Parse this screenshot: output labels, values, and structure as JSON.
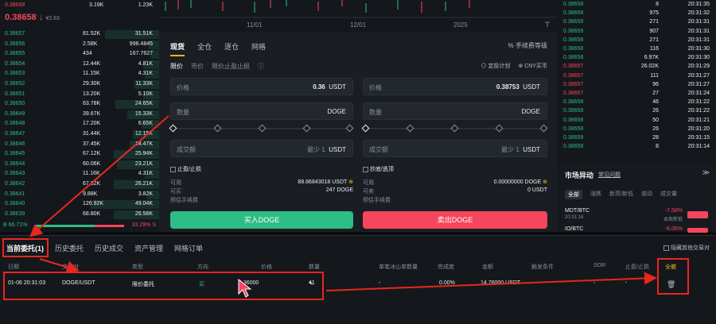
{
  "colors": {
    "buy": "#2ebd85",
    "sell": "#f6465d",
    "accent": "#f0b90b",
    "annotation": "#e8271f"
  },
  "orderbook": {
    "top_row": {
      "price": "0.38658",
      "qty": "3.19K",
      "total": "1.23K"
    },
    "mid_price": "0.38658",
    "mid_arrow": "↓",
    "mid_fiat": "¥2.83",
    "rows": [
      {
        "price": "0.38657",
        "qty": "81.52K",
        "total": "31.51K",
        "bar": 0.62
      },
      {
        "price": "0.38656",
        "qty": "2.58K",
        "total": "998.4845",
        "bar": 0.12
      },
      {
        "price": "0.38655",
        "qty": "434",
        "total": "167.7627",
        "bar": 0.1
      },
      {
        "price": "0.38654",
        "qty": "12.44K",
        "total": "4.81K",
        "bar": 0.18
      },
      {
        "price": "0.38653",
        "qty": "11.15K",
        "total": "4.31K",
        "bar": 0.16
      },
      {
        "price": "0.38652",
        "qty": "29.30K",
        "total": "11.33K",
        "bar": 0.28
      },
      {
        "price": "0.38651",
        "qty": "13.20K",
        "total": "5.10K",
        "bar": 0.18
      },
      {
        "price": "0.38650",
        "qty": "63.78K",
        "total": "24.65K",
        "bar": 0.5
      },
      {
        "price": "0.38649",
        "qty": "39.67K",
        "total": "15.33K",
        "bar": 0.36
      },
      {
        "price": "0.38648",
        "qty": "17.20K",
        "total": "6.65K",
        "bar": 0.2
      },
      {
        "price": "0.38647",
        "qty": "31.44K",
        "total": "12.15K",
        "bar": 0.3
      },
      {
        "price": "0.38646",
        "qty": "37.45K",
        "total": "14.47K",
        "bar": 0.34
      },
      {
        "price": "0.38645",
        "qty": "67.12K",
        "total": "25.94K",
        "bar": 0.52
      },
      {
        "price": "0.38644",
        "qty": "60.06K",
        "total": "23.21K",
        "bar": 0.48
      },
      {
        "price": "0.38643",
        "qty": "11.16K",
        "total": "4.31K",
        "bar": 0.16
      },
      {
        "price": "0.38642",
        "qty": "67.82K",
        "total": "26.21K",
        "bar": 0.52
      },
      {
        "price": "0.38641",
        "qty": "9.88K",
        "total": "3.82K",
        "bar": 0.14
      },
      {
        "price": "0.38640",
        "qty": "126.92K",
        "total": "49.04K",
        "bar": 0.78
      },
      {
        "price": "0.38639",
        "qty": "68.80K",
        "total": "26.58K",
        "bar": 0.52
      }
    ],
    "ratio_buy": "B 66.71%",
    "ratio_sell": "33.29% S",
    "ratio_buy_value": 0.6671
  },
  "chart": {
    "x_ticks": [
      "11/01",
      "12/01",
      "2025"
    ]
  },
  "form": {
    "tabs": [
      "现货",
      "全仓",
      "逐仓",
      "网格"
    ],
    "fee_label": "手续费等级",
    "order_types": [
      "限价",
      "市价",
      "限价止盈止损"
    ],
    "plan_label": "定投计划",
    "currency_label": "CNY买币",
    "buy": {
      "price_label": "价格",
      "price_value": "0.36",
      "price_unit": "USDT",
      "qty_label": "数量",
      "qty_unit": "DOGE",
      "amount_label": "成交额",
      "amount_placeholder": "最少 1",
      "amount_unit": "USDT",
      "tpsl_label": "止盈/止损",
      "available_label": "可用",
      "available_value": "88.86843018 USDT",
      "can_buy_label": "可买",
      "can_buy_value": "247 DOGE",
      "fee_est_label": "预估手续费",
      "button": "买入DOGE"
    },
    "sell": {
      "price_label": "价格",
      "price_value": "0.38753",
      "price_unit": "USDT",
      "qty_label": "数量",
      "qty_unit": "DOGE",
      "amount_label": "成交额",
      "amount_placeholder": "最少 1",
      "amount_unit": "USDT",
      "option_label": "抄底/逃顶",
      "available_label": "可用",
      "available_value": "0.00000000 DOGE",
      "can_sell_label": "可卖",
      "can_sell_value": "0 USDT",
      "fee_est_label": "预估手续费",
      "button": "卖出DOGE"
    }
  },
  "trades": {
    "rows": [
      {
        "price": "0.38658",
        "qty": "8",
        "time": "20:31:35",
        "side": "buy"
      },
      {
        "price": "0.38658",
        "qty": "975",
        "time": "20:31:32",
        "side": "buy"
      },
      {
        "price": "0.38659",
        "qty": "271",
        "time": "20:31:31",
        "side": "buy"
      },
      {
        "price": "0.38659",
        "qty": "907",
        "time": "20:31:31",
        "side": "buy"
      },
      {
        "price": "0.38658",
        "qty": "271",
        "time": "20:31:31",
        "side": "buy"
      },
      {
        "price": "0.38658",
        "qty": "116",
        "time": "20:31:30",
        "side": "buy"
      },
      {
        "price": "0.38658",
        "qty": "6.97K",
        "time": "20:31:30",
        "side": "buy"
      },
      {
        "price": "0.38657",
        "qty": "26.02K",
        "time": "20:31:29",
        "side": "sell"
      },
      {
        "price": "0.38657",
        "qty": "111",
        "time": "20:31:27",
        "side": "sell"
      },
      {
        "price": "0.38657",
        "qty": "96",
        "time": "20:31:27",
        "side": "sell"
      },
      {
        "price": "0.38657",
        "qty": "27",
        "time": "20:31:24",
        "side": "sell"
      },
      {
        "price": "0.38658",
        "qty": "46",
        "time": "20:31:22",
        "side": "buy"
      },
      {
        "price": "0.38658",
        "qty": "26",
        "time": "20:31:22",
        "side": "buy"
      },
      {
        "price": "0.38658",
        "qty": "50",
        "time": "20:31:21",
        "side": "buy"
      },
      {
        "price": "0.38658",
        "qty": "26",
        "time": "20:31:20",
        "side": "buy"
      },
      {
        "price": "0.38659",
        "qty": "28",
        "time": "20:31:15",
        "side": "buy"
      },
      {
        "price": "0.38658",
        "qty": "8",
        "time": "20:31:14",
        "side": "buy"
      }
    ]
  },
  "market": {
    "title": "市场异动",
    "link": "常见问题",
    "tabs": [
      "全部",
      "涨跌",
      "新高/新低",
      "波动",
      "成交量"
    ],
    "items": [
      {
        "pair": "MDT/BTC",
        "time": "20:31:16",
        "change": "-7.58%",
        "desc": "本周新低"
      },
      {
        "pair": "IO/BTC",
        "time": "",
        "change": "-6.06%",
        "desc": ""
      }
    ]
  },
  "orders": {
    "tabs": [
      "当前委托(1)",
      "历史委托",
      "历史成交",
      "资产管理",
      "网格订单"
    ],
    "hide_others": "隐藏其他交易对",
    "headers": [
      "日期",
      "交易对",
      "类型",
      "方向",
      "价格",
      "数量",
      "单笔冰山单数量",
      "完成度",
      "金额",
      "触发条件",
      "SOR",
      "止盈/止损",
      "全撤"
    ],
    "row": {
      "date": "01-06 20:31:03",
      "pair": "DOGE/USDT",
      "type": "限价委托",
      "side": "买",
      "price": "0.36000",
      "qty": "41",
      "iceberg": "-",
      "fill": "0.00%",
      "amount": "14.76000 USDT",
      "trigger": "-",
      "sor": "-",
      "tpsl": "-"
    }
  }
}
